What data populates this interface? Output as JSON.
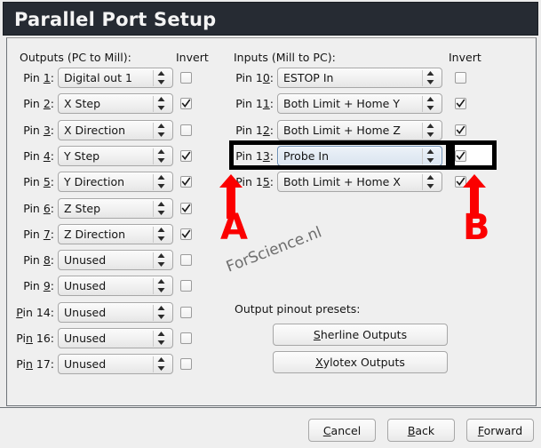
{
  "window": {
    "title": "Parallel Port Setup"
  },
  "outputs": {
    "heading": "Outputs (PC to Mill):",
    "invert_heading": "Invert",
    "rows": [
      {
        "label_pre": "Pin ",
        "label_mn": "1",
        "label_post": ":",
        "value": "Digital out 1",
        "invert": false
      },
      {
        "label_pre": "Pin ",
        "label_mn": "2",
        "label_post": ":",
        "value": "X Step",
        "invert": true
      },
      {
        "label_pre": "Pin ",
        "label_mn": "3",
        "label_post": ":",
        "value": "X Direction",
        "invert": false
      },
      {
        "label_pre": "Pin ",
        "label_mn": "4",
        "label_post": ":",
        "value": "Y Step",
        "invert": true
      },
      {
        "label_pre": "Pin ",
        "label_mn": "5",
        "label_post": ":",
        "value": "Y Direction",
        "invert": true
      },
      {
        "label_pre": "Pin ",
        "label_mn": "6",
        "label_post": ":",
        "value": "Z Step",
        "invert": true
      },
      {
        "label_pre": "Pin ",
        "label_mn": "7",
        "label_post": ":",
        "value": "Z Direction",
        "invert": true
      },
      {
        "label_pre": "Pin ",
        "label_mn": "8",
        "label_post": ":",
        "value": "Unused",
        "invert": false
      },
      {
        "label_pre": "Pin ",
        "label_mn": "9",
        "label_post": ":",
        "value": "Unused",
        "invert": false
      },
      {
        "label_pre": "",
        "label_mn": "P",
        "label_post": "in 14:",
        "value": "Unused",
        "invert": false
      },
      {
        "label_pre": "Pi",
        "label_mn": "n",
        "label_post": " 16:",
        "value": "Unused",
        "invert": false
      },
      {
        "label_pre": "Pi",
        "label_mn": "n",
        "label_post": " 17:",
        "value": "Unused",
        "invert": false
      }
    ]
  },
  "inputs": {
    "heading": "Inputs (Mill to PC):",
    "invert_heading": "Invert",
    "rows": [
      {
        "label_pre": "Pin 1",
        "label_mn": "0",
        "label_post": ":",
        "value": "ESTOP In",
        "invert": false,
        "focused": false
      },
      {
        "label_pre": "Pin 1",
        "label_mn": "1",
        "label_post": ":",
        "value": "Both Limit + Home Y",
        "invert": true,
        "focused": false
      },
      {
        "label_pre": "Pin 1",
        "label_mn": "2",
        "label_post": ":",
        "value": "Both Limit + Home Z",
        "invert": true,
        "focused": false
      },
      {
        "label_pre": "Pin 1",
        "label_mn": "3",
        "label_post": ":",
        "value": "Probe In",
        "invert": true,
        "focused": true
      },
      {
        "label_pre": "Pin 1",
        "label_mn": "5",
        "label_post": ":",
        "value": "Both Limit + Home X",
        "invert": true,
        "focused": false
      }
    ]
  },
  "presets": {
    "label": "Output pinout presets:",
    "buttons": [
      {
        "mn": "S",
        "rest": "herline Outputs"
      },
      {
        "mn": "X",
        "rest": "ylotex Outputs"
      }
    ]
  },
  "footer": {
    "buttons": [
      {
        "mn": "C",
        "pre": "",
        "rest": "ancel"
      },
      {
        "mn": "B",
        "pre": "",
        "rest": "ack"
      },
      {
        "mn": "F",
        "pre": "",
        "rest": "orward"
      }
    ]
  },
  "annotations": {
    "watermark": "ForScience.nl",
    "marker_a": "A",
    "marker_b": "B",
    "marker_color": "#fb0000"
  },
  "icons": {
    "combo_arrows": "up-down-arrows-icon",
    "checkmark": "checkmark-icon",
    "arrow_up": "arrow-up-icon"
  }
}
